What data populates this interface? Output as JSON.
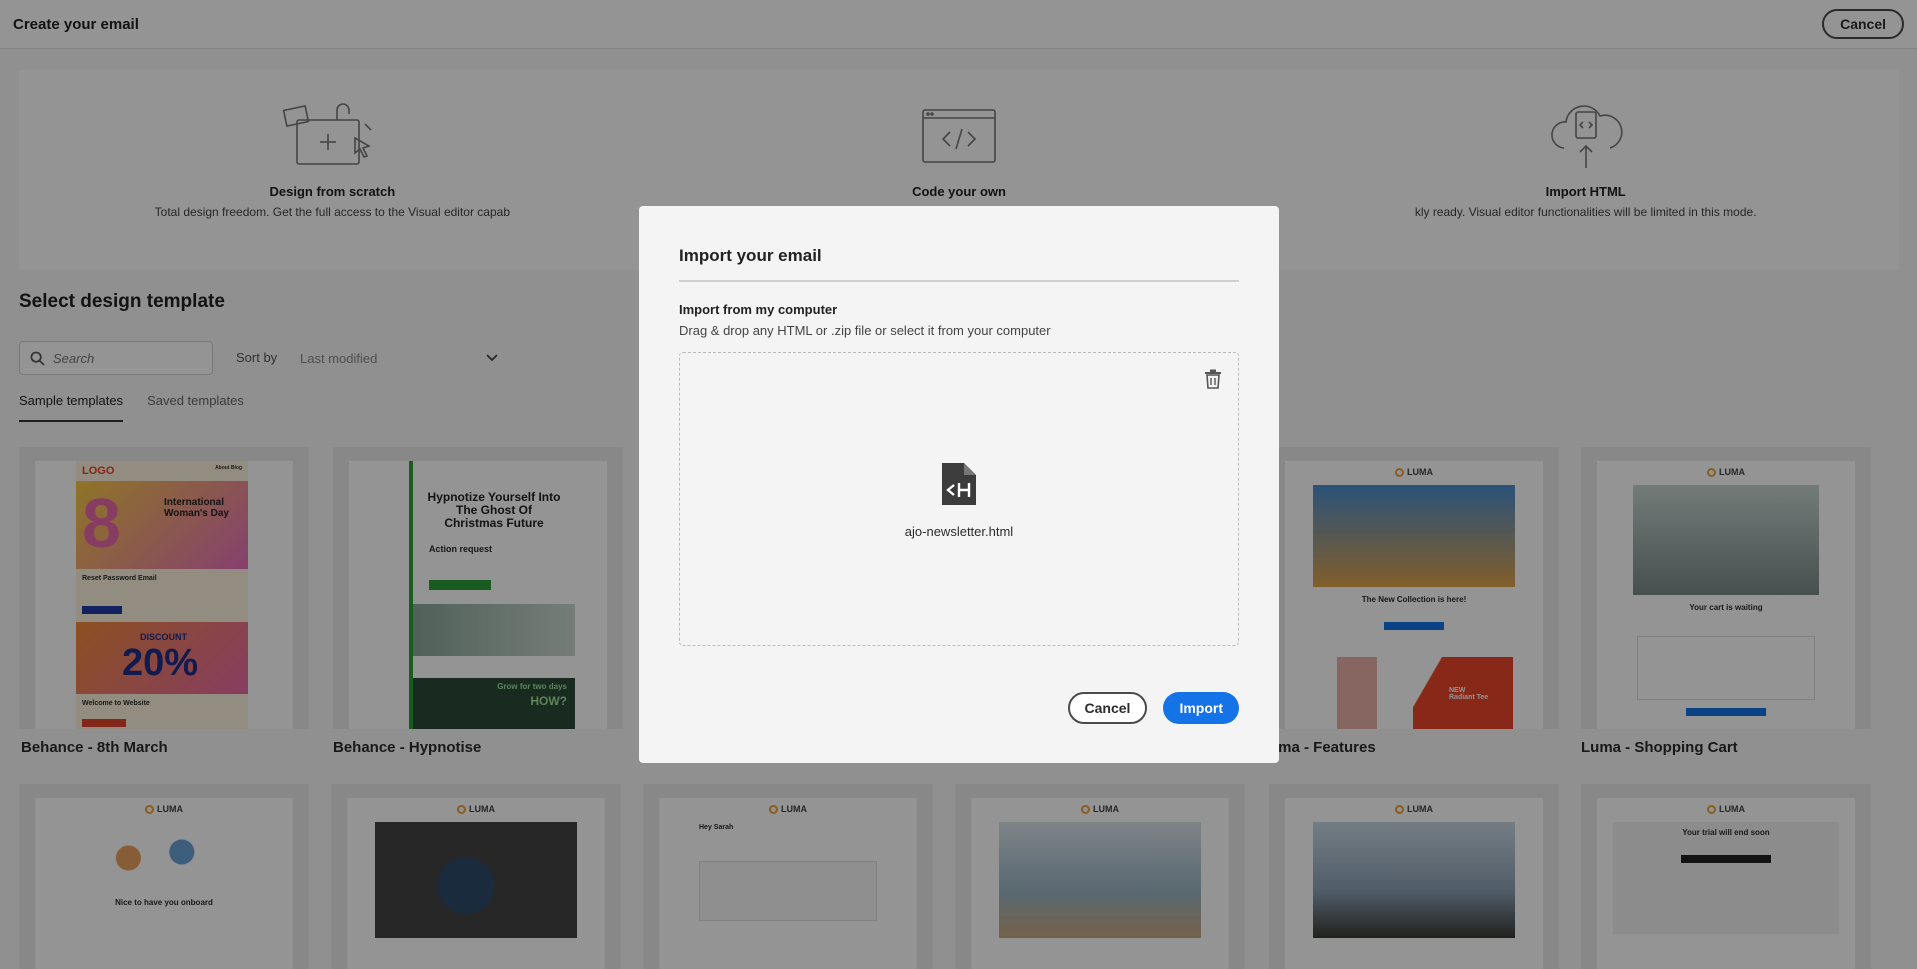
{
  "header": {
    "title": "Create your email",
    "cancel_label": "Cancel"
  },
  "options": [
    {
      "title": "Design from scratch",
      "description": "Total design freedom. Get the full access to the Visual editor capab",
      "icon": "design-canvas-icon"
    },
    {
      "title": "Code your own",
      "description": "",
      "icon": "code-window-icon"
    },
    {
      "title": "Import HTML",
      "description": "kly ready. Visual editor functionalities will be limited in this mode.",
      "icon": "cloud-upload-icon"
    }
  ],
  "templates_section": {
    "title": "Select design template",
    "search_placeholder": "Search",
    "sort_label": "Sort by",
    "sort_value": "Last modified",
    "tabs": [
      "Sample templates",
      "Saved templates"
    ]
  },
  "templates": {
    "row1": [
      "Behance - 8th March",
      "Behance - Hypnotise",
      "uma - Features",
      "Luma - Shopping Cart"
    ],
    "thumb_texts": {
      "march_logo": "LOGO",
      "march_nav": "About   Blog",
      "march_title": "International Woman's Day",
      "march_reset": "Reset Password Email",
      "march_discount": "DISCOUNT",
      "march_percent": "20%",
      "march_welcome": "Welcome to Website",
      "hyp_title": "Hypnotize Yourself Into The Ghost Of Christmas Future",
      "hyp_action": "Action request",
      "hyp_grow": "Grow for two days",
      "hyp_how": "HOW?",
      "luma": "LUMA",
      "features_collection": "The New Collection is here!",
      "features_tee": "NEW Radiant Tee",
      "cart_waiting": "Your cart is waiting",
      "onboard": "Nice to have you onboard",
      "order_greeting": "Hey Sarah",
      "trial": "Your trial will end soon"
    }
  },
  "dialog": {
    "title": "Import your email",
    "subtitle": "Import from my computer",
    "description": "Drag & drop any HTML or .zip file or select it from your computer",
    "file_name": "ajo-newsletter.html",
    "cancel_label": "Cancel",
    "import_label": "Import"
  },
  "colors": {
    "accent": "#1473e6",
    "overlay": "rgba(0,0,0,0.42)"
  }
}
